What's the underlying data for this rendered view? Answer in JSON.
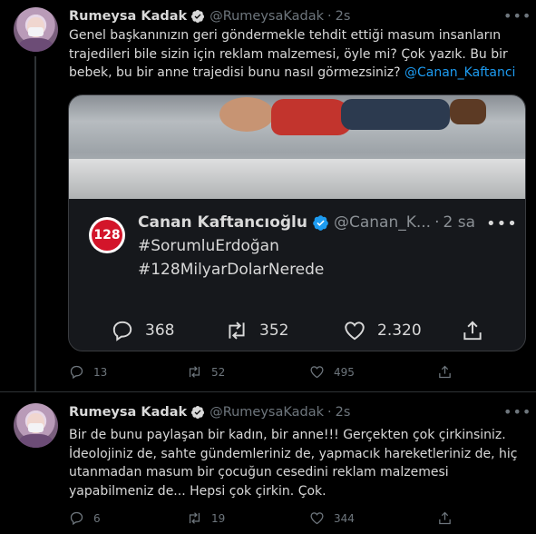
{
  "tweets": [
    {
      "author": {
        "name": "Rumeysa Kadak",
        "handle": "@RumeysaKadak",
        "time": "2s"
      },
      "text_before": "Genel başkanınızın geri göndermekle tehdit ettiği masum insanların trajedileri bile sizin için reklam malzemesi, öyle mi? Çok yazık. Bu bir bebek, bu bir anne trajedisi bunu nasıl görmezsiniz? ",
      "mention": "@Canan_Kaftanci",
      "quote": {
        "avatar_text": "128",
        "name": "Canan Kaftancıoğlu",
        "handle": "@Canan_K...",
        "time": "2 sa",
        "lines": [
          "#SorumluErdoğan",
          "#128MilyarDolarNerede"
        ],
        "actions": {
          "replies": "368",
          "retweets": "352",
          "likes": "2.320"
        }
      },
      "actions": {
        "replies": "13",
        "retweets": "52",
        "likes": "495"
      }
    },
    {
      "author": {
        "name": "Rumeysa Kadak",
        "handle": "@RumeysaKadak",
        "time": "2s"
      },
      "text": "Bir de bunu paylaşan bir kadın, bir anne!!! Gerçekten çok çirkinsiniz. İdeolojiniz de, sahte gündemleriniz de, yapmacık hareketleriniz de, hiç utanmadan masum bir çocuğun cesedini reklam malzemesi yapabilmeniz de... Hepsi çok çirkin. Çok.",
      "actions": {
        "replies": "6",
        "retweets": "19",
        "likes": "344"
      }
    }
  ],
  "icons": {
    "verified": "verified-badge-icon",
    "more": "more-dots-icon",
    "reply": "reply-icon",
    "retweet": "retweet-icon",
    "like": "heart-icon",
    "share": "share-icon"
  },
  "colors": {
    "background": "#000000",
    "accent": "#1d9bf0",
    "muted": "#6e767d",
    "text": "#d9d9d9"
  }
}
